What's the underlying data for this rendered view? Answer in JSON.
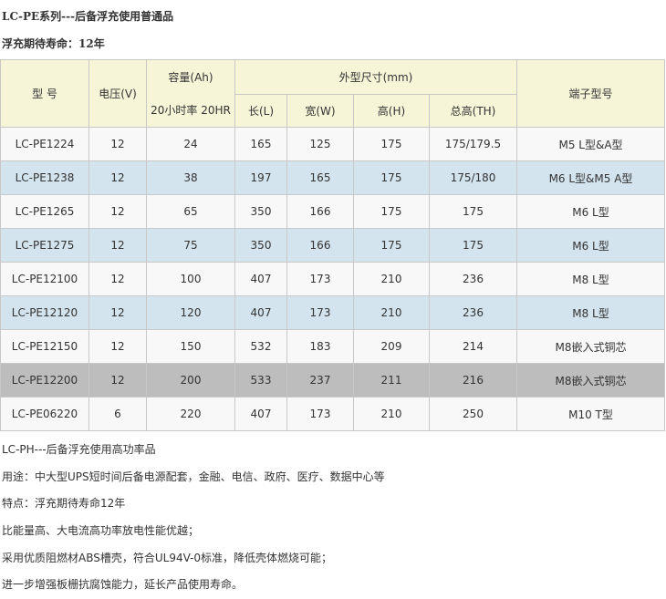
{
  "heading_series": "LC-PE系列---后备浮充使用普通品",
  "heading_life": "浮充期待寿命：12年",
  "table": {
    "header": {
      "model": "型 号",
      "voltage": "电压(V)",
      "capacity": "容量(Ah)",
      "capacity_sub": "20小时率 20HR",
      "dimensions": "外型尺寸(mm)",
      "length": "长(L)",
      "width": "宽(W)",
      "height": "高(H)",
      "total_height": "总高(TH)",
      "terminal": "端子型号"
    },
    "rows": [
      {
        "model": "LC-PE1224",
        "voltage": "12",
        "capacity": "24",
        "length": "165",
        "width": "125",
        "height": "175",
        "total_height": "175/179.5",
        "terminal": "M5 L型&A型"
      },
      {
        "model": "LC-PE1238",
        "voltage": "12",
        "capacity": "38",
        "length": "197",
        "width": "165",
        "height": "175",
        "total_height": "175/180",
        "terminal": "M6 L型&M5 A型"
      },
      {
        "model": "LC-PE1265",
        "voltage": "12",
        "capacity": "65",
        "length": "350",
        "width": "166",
        "height": "175",
        "total_height": "175",
        "terminal": "M6 L型"
      },
      {
        "model": "LC-PE1275",
        "voltage": "12",
        "capacity": "75",
        "length": "350",
        "width": "166",
        "height": "175",
        "total_height": "175",
        "terminal": "M6 L型"
      },
      {
        "model": "LC-PE12100",
        "voltage": "12",
        "capacity": "100",
        "length": "407",
        "width": "173",
        "height": "210",
        "total_height": "236",
        "terminal": "M8 L型"
      },
      {
        "model": "LC-PE12120",
        "voltage": "12",
        "capacity": "120",
        "length": "407",
        "width": "173",
        "height": "210",
        "total_height": "236",
        "terminal": "M8 L型"
      },
      {
        "model": "LC-PE12150",
        "voltage": "12",
        "capacity": "150",
        "length": "532",
        "width": "183",
        "height": "209",
        "total_height": "214",
        "terminal": "M8嵌入式铜芯"
      },
      {
        "model": "LC-PE12200",
        "voltage": "12",
        "capacity": "200",
        "length": "533",
        "width": "237",
        "height": "211",
        "total_height": "216",
        "terminal": "M8嵌入式铜芯"
      },
      {
        "model": "LC-PE06220",
        "voltage": "6",
        "capacity": "220",
        "length": "407",
        "width": "173",
        "height": "210",
        "total_height": "250",
        "terminal": "M10 T型"
      }
    ]
  },
  "paragraphs": [
    "LC-PH---后备浮充使用高功率品",
    "用途：中大型UPS短时间后备电源配套，金融、电信、政府、医疗、数据中心等",
    "特点：浮充期待寿命12年",
    "比能量高、大电流高功率放电性能优越；",
    "采用优质阻燃材ABS槽壳，符合UL94V-0标准，降低壳体燃烧可能；",
    "进一步增强板栅抗腐蚀能力，延长产品使用寿命。"
  ],
  "colors": {
    "header_bg": "#f7f5d8",
    "row_white": "#f8f8f8",
    "row_blue": "#d3e4ee",
    "row_gray": "#bdbdbd",
    "border": "#c8c8c8",
    "text": "#333333"
  }
}
